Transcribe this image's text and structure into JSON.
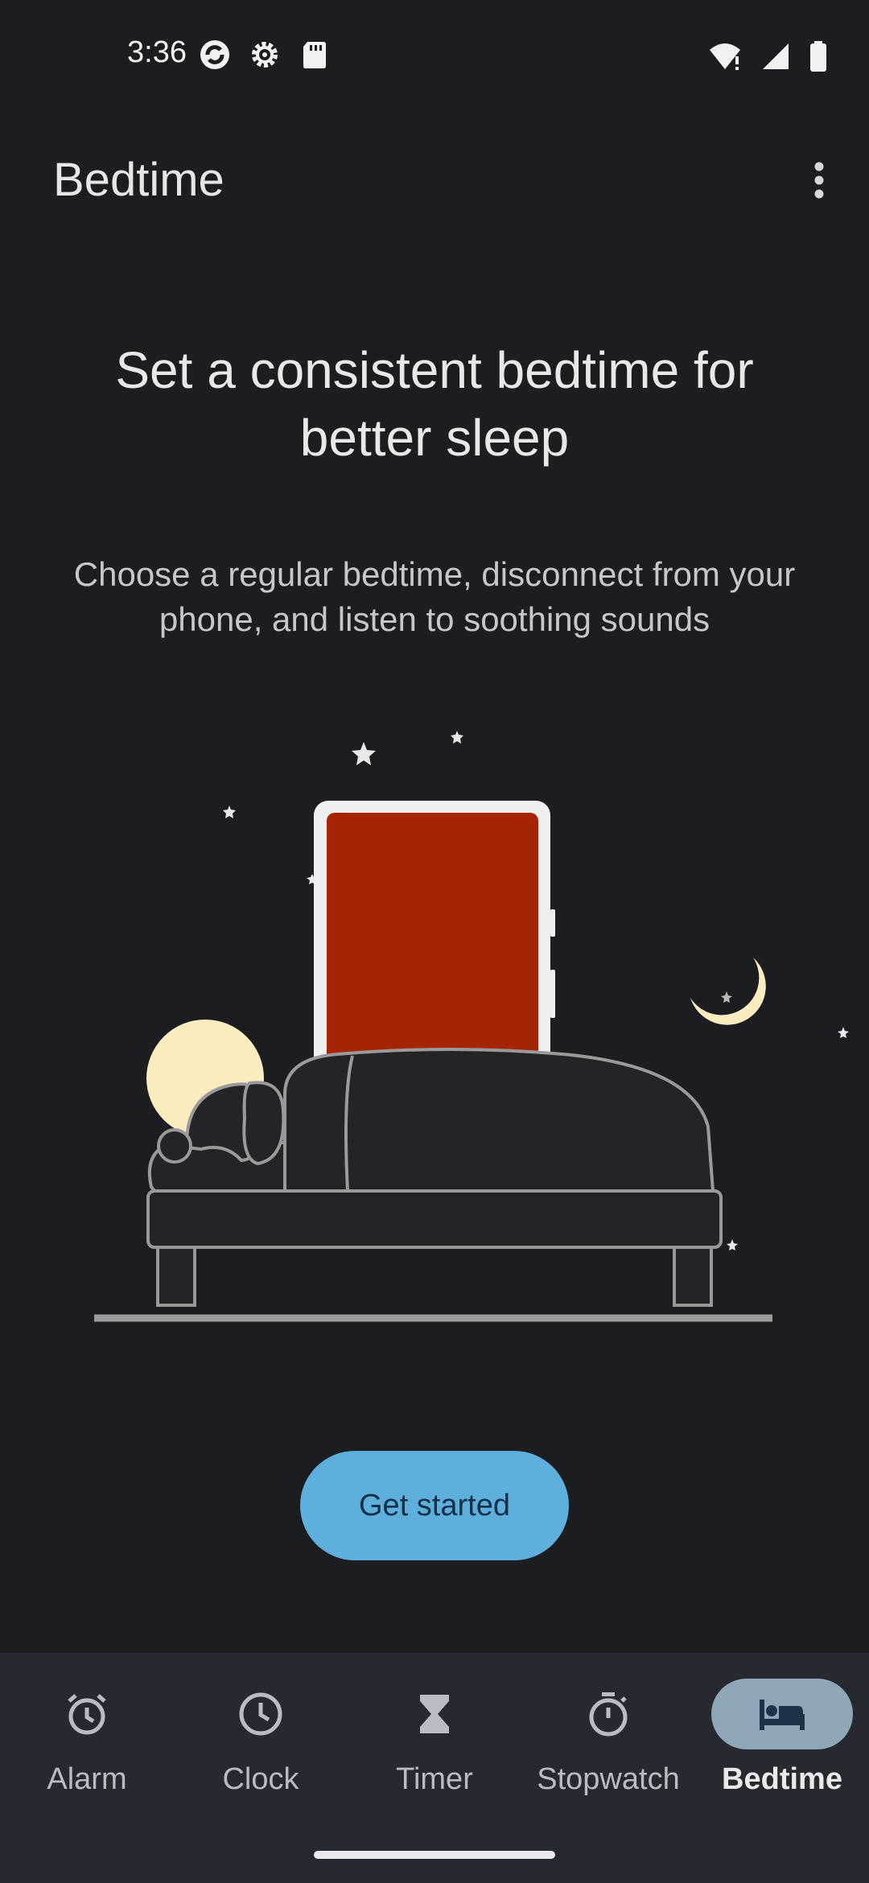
{
  "status_bar": {
    "time": "3:36",
    "icons": [
      "sync-icon",
      "settings-icon",
      "sd-card-icon",
      "wifi-icon",
      "signal-icon",
      "battery-icon"
    ]
  },
  "app_bar": {
    "title": "Bedtime",
    "menu_icon": "more-vert-icon"
  },
  "onboarding": {
    "headline": "Set a consistent bedtime for better sleep",
    "description": "Choose a regular bedtime, disconnect from your phone, and listen to soothing sounds",
    "illustration": "sleeping-person-bed-phone-moon",
    "cta_label": "Get started"
  },
  "bottom_nav": {
    "items": [
      {
        "label": "Alarm",
        "icon": "alarm-icon",
        "active": false
      },
      {
        "label": "Clock",
        "icon": "clock-icon",
        "active": false
      },
      {
        "label": "Timer",
        "icon": "hourglass-icon",
        "active": false
      },
      {
        "label": "Stopwatch",
        "icon": "stopwatch-icon",
        "active": false
      },
      {
        "label": "Bedtime",
        "icon": "bed-icon",
        "active": true
      }
    ]
  },
  "colors": {
    "background": "#1b1d21",
    "nav_background": "#262a30",
    "accent_button": "#5eafdc",
    "active_pill": "#8fa8b8",
    "phone_screen": "#a52404",
    "moon": "#fbedbf"
  }
}
